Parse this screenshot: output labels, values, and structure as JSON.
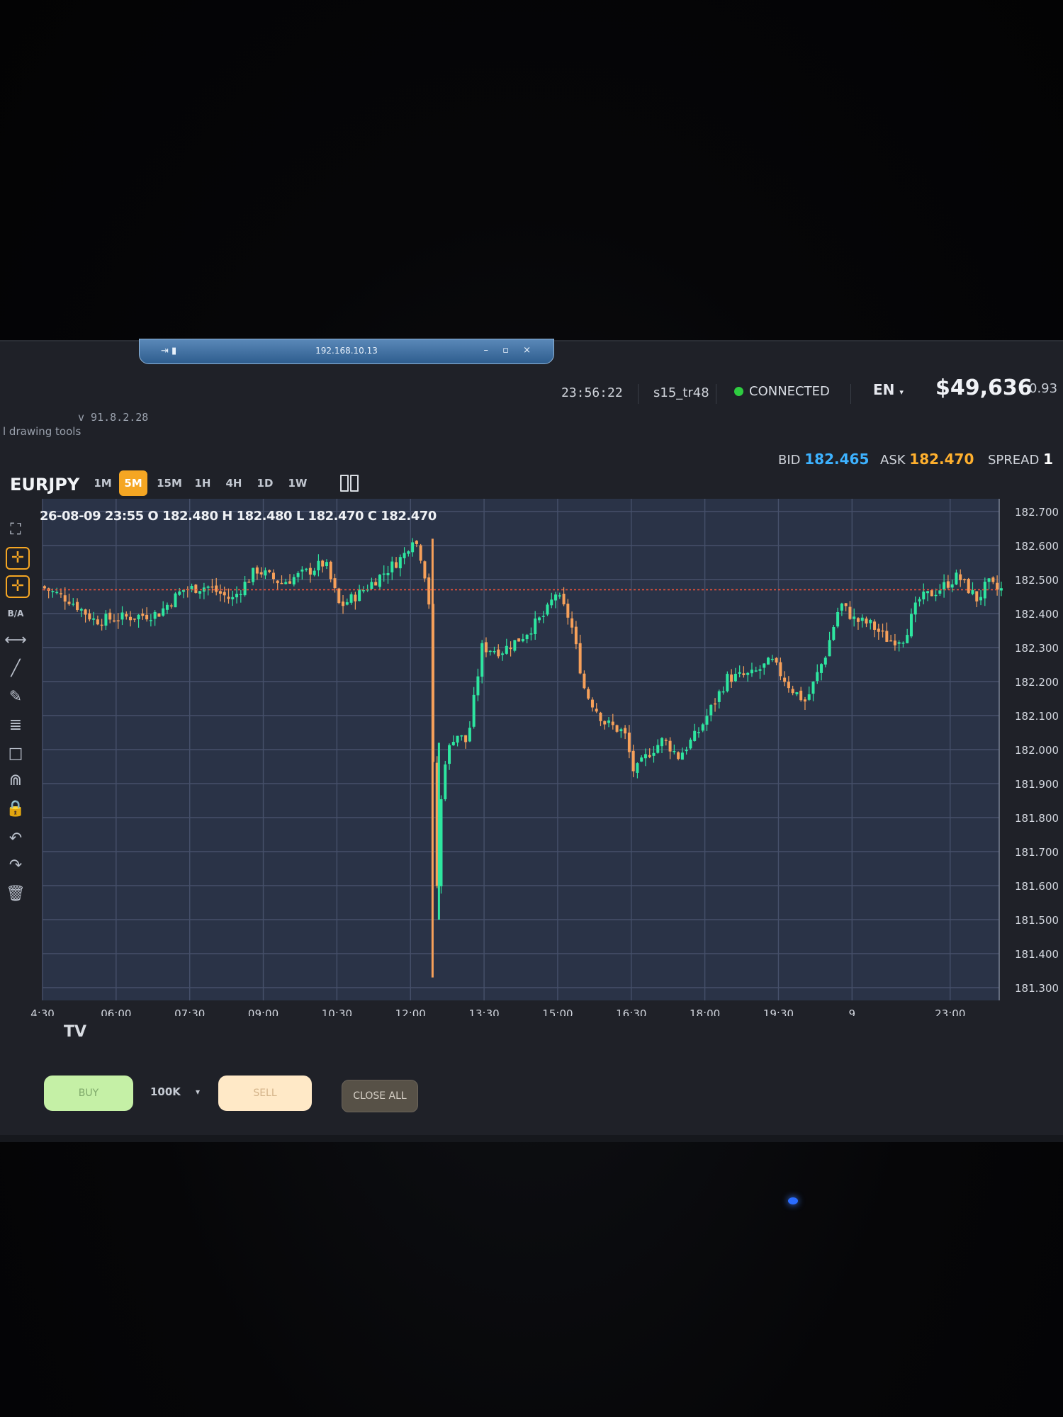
{
  "remote_bar": {
    "address": "192.168.10.13",
    "left_icons": "⇥ ▮",
    "right_controls": "– ▫ ×"
  },
  "header": {
    "clock": "23:56:22",
    "user": "s15_tr48",
    "status": "CONNECTED",
    "language": "EN",
    "language_caret": "▾",
    "balance": "$49,636",
    "extra": "0.93",
    "version": "v 91.8.2.28",
    "drawing_tools_label": "l drawing tools"
  },
  "toolbar": {
    "symbol": "EURJPY",
    "timeframes": [
      {
        "label": "1M",
        "active": false
      },
      {
        "label": "5M",
        "active": true
      },
      {
        "label": "15M",
        "active": false
      },
      {
        "label": "1H",
        "active": false
      },
      {
        "label": "4H",
        "active": false
      },
      {
        "label": "1D",
        "active": false
      },
      {
        "label": "1W",
        "active": false
      }
    ]
  },
  "quotes": {
    "bid_label": "BID",
    "bid": "182.465",
    "ask_label": "ASK",
    "ask": "182.470",
    "spread_label": "SPREAD",
    "spread": "1"
  },
  "ohlc": {
    "text": "26-08-09 23:55 O 182.480 H 182.480 L 182.470 C 182.470"
  },
  "side_tools": [
    {
      "name": "fullscreen-icon",
      "glyph": "⛶"
    },
    {
      "name": "crosshair-icon",
      "glyph": "✛"
    },
    {
      "name": "cursor-icon",
      "glyph": "✛"
    },
    {
      "name": "bid-ask-label",
      "glyph": "B/A"
    },
    {
      "name": "horizontal-ray-icon",
      "glyph": "⟷"
    },
    {
      "name": "trend-line-icon",
      "glyph": "╱"
    },
    {
      "name": "brush-icon",
      "glyph": "✎"
    },
    {
      "name": "fib-icon",
      "glyph": "≣"
    },
    {
      "name": "rectangle-icon",
      "glyph": "□"
    },
    {
      "name": "magnet-icon",
      "glyph": "⋒"
    },
    {
      "name": "lock-icon",
      "glyph": "🔒"
    },
    {
      "name": "undo-icon",
      "glyph": "↶"
    },
    {
      "name": "redo-icon",
      "glyph": "↷"
    },
    {
      "name": "trash-icon",
      "glyph": "🗑"
    }
  ],
  "trade_bar": {
    "buy": "BUY",
    "size": "100K",
    "size_caret": "▾",
    "sell": "SELL",
    "close_all": "CLOSE ALL"
  },
  "tv_logo": "TV",
  "colors": {
    "up": "#2ee6a0",
    "down": "#f6a05a",
    "price_line": "#e8523a",
    "accent": "#f5a623",
    "bid": "#3db2ff",
    "ask": "#ffb02e"
  },
  "chart_data": {
    "type": "candlestick",
    "symbol": "EURJPY",
    "interval": "5M",
    "ylim": [
      181.3,
      182.7
    ],
    "y_ticks": [
      182.7,
      182.6,
      182.5,
      182.4,
      182.3,
      182.2,
      182.1,
      182.0,
      181.9,
      181.8,
      181.7,
      181.6,
      181.5,
      181.4,
      181.3
    ],
    "y_tick_labels": [
      "182.700",
      "182.600",
      "182.500",
      "182.400",
      "182.300",
      "182.200",
      "182.100",
      "182.000",
      "181.900",
      "181.800",
      "181.700",
      "181.600",
      "181.500",
      "181.400",
      "181.300"
    ],
    "x_range_hours": [
      4.5,
      24.0
    ],
    "x_ticks": [
      {
        "t": 4.5,
        "label": "4:30"
      },
      {
        "t": 6.0,
        "label": "06:00"
      },
      {
        "t": 7.5,
        "label": "07:30"
      },
      {
        "t": 9.0,
        "label": "09:00"
      },
      {
        "t": 10.5,
        "label": "10:30"
      },
      {
        "t": 12.0,
        "label": "12:00"
      },
      {
        "t": 13.5,
        "label": "13:30"
      },
      {
        "t": 15.0,
        "label": "15:00"
      },
      {
        "t": 16.5,
        "label": "16:30"
      },
      {
        "t": 18.0,
        "label": "18:00"
      },
      {
        "t": 19.5,
        "label": "19:30"
      },
      {
        "t": 21.0,
        "label": "9"
      },
      {
        "t": 23.0,
        "label": "23:00"
      }
    ],
    "current_price": 182.47,
    "close_path": [
      {
        "t": 4.5,
        "p": 182.48
      },
      {
        "t": 5.1,
        "p": 182.44
      },
      {
        "t": 5.6,
        "p": 182.38
      },
      {
        "t": 6.3,
        "p": 182.39
      },
      {
        "t": 6.9,
        "p": 182.4
      },
      {
        "t": 7.4,
        "p": 182.47
      },
      {
        "t": 7.9,
        "p": 182.48
      },
      {
        "t": 8.4,
        "p": 182.44
      },
      {
        "t": 8.9,
        "p": 182.53
      },
      {
        "t": 9.4,
        "p": 182.49
      },
      {
        "t": 9.9,
        "p": 182.52
      },
      {
        "t": 10.3,
        "p": 182.55
      },
      {
        "t": 10.6,
        "p": 182.42
      },
      {
        "t": 11.0,
        "p": 182.46
      },
      {
        "t": 11.5,
        "p": 182.52
      },
      {
        "t": 11.9,
        "p": 182.57
      },
      {
        "t": 12.1,
        "p": 182.63
      },
      {
        "t": 12.3,
        "p": 182.55
      },
      {
        "t": 12.45,
        "p": 182.4
      },
      {
        "t": 12.55,
        "p": 181.5
      },
      {
        "t": 12.7,
        "p": 181.95
      },
      {
        "t": 12.95,
        "p": 182.05
      },
      {
        "t": 13.2,
        "p": 182.02
      },
      {
        "t": 13.5,
        "p": 182.3
      },
      {
        "t": 13.9,
        "p": 182.29
      },
      {
        "t": 14.3,
        "p": 182.33
      },
      {
        "t": 14.8,
        "p": 182.4
      },
      {
        "t": 15.0,
        "p": 182.46
      },
      {
        "t": 15.3,
        "p": 182.38
      },
      {
        "t": 15.6,
        "p": 182.17
      },
      {
        "t": 16.0,
        "p": 182.08
      },
      {
        "t": 16.4,
        "p": 182.05
      },
      {
        "t": 16.6,
        "p": 181.93
      },
      {
        "t": 16.9,
        "p": 181.99
      },
      {
        "t": 17.2,
        "p": 182.03
      },
      {
        "t": 17.5,
        "p": 181.98
      },
      {
        "t": 17.9,
        "p": 182.05
      },
      {
        "t": 18.2,
        "p": 182.13
      },
      {
        "t": 18.5,
        "p": 182.21
      },
      {
        "t": 19.0,
        "p": 182.22
      },
      {
        "t": 19.4,
        "p": 182.26
      },
      {
        "t": 19.8,
        "p": 182.18
      },
      {
        "t": 20.1,
        "p": 182.14
      },
      {
        "t": 20.5,
        "p": 182.28
      },
      {
        "t": 20.8,
        "p": 182.43
      },
      {
        "t": 21.1,
        "p": 182.38
      },
      {
        "t": 21.4,
        "p": 182.37
      },
      {
        "t": 21.8,
        "p": 182.32
      },
      {
        "t": 22.1,
        "p": 182.33
      },
      {
        "t": 22.4,
        "p": 182.44
      },
      {
        "t": 22.8,
        "p": 182.47
      },
      {
        "t": 23.2,
        "p": 182.51
      },
      {
        "t": 23.6,
        "p": 182.44
      },
      {
        "t": 23.8,
        "p": 182.49
      },
      {
        "t": 24.0,
        "p": 182.47
      }
    ]
  }
}
